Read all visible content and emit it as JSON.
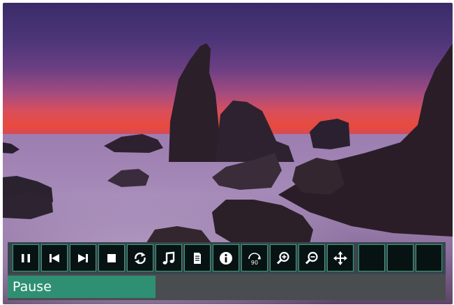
{
  "player": {
    "status_label": "Pause",
    "controls": [
      {
        "name": "pause-button",
        "icon": "pause-icon"
      },
      {
        "name": "previous-button",
        "icon": "skip-previous-icon"
      },
      {
        "name": "next-button",
        "icon": "skip-next-icon"
      },
      {
        "name": "stop-button",
        "icon": "stop-icon"
      },
      {
        "name": "repeat-button",
        "icon": "repeat-icon"
      },
      {
        "name": "music-button",
        "icon": "music-note-icon"
      },
      {
        "name": "document-button",
        "icon": "document-icon"
      },
      {
        "name": "info-button",
        "icon": "info-icon"
      },
      {
        "name": "rotate-button",
        "icon": "rotate-90-icon",
        "label": "90"
      },
      {
        "name": "zoom-in-button",
        "icon": "zoom-in-icon"
      },
      {
        "name": "zoom-out-button",
        "icon": "zoom-out-icon"
      },
      {
        "name": "pan-button",
        "icon": "move-arrows-icon"
      },
      {
        "name": "empty-slot",
        "icon": ""
      },
      {
        "name": "empty-slot",
        "icon": ""
      },
      {
        "name": "empty-slot",
        "icon": ""
      }
    ]
  },
  "colors": {
    "accent": "#2f8f72",
    "button_border": "#3d9e80",
    "button_bg": "#071212",
    "bar_bg": "#37474d"
  }
}
